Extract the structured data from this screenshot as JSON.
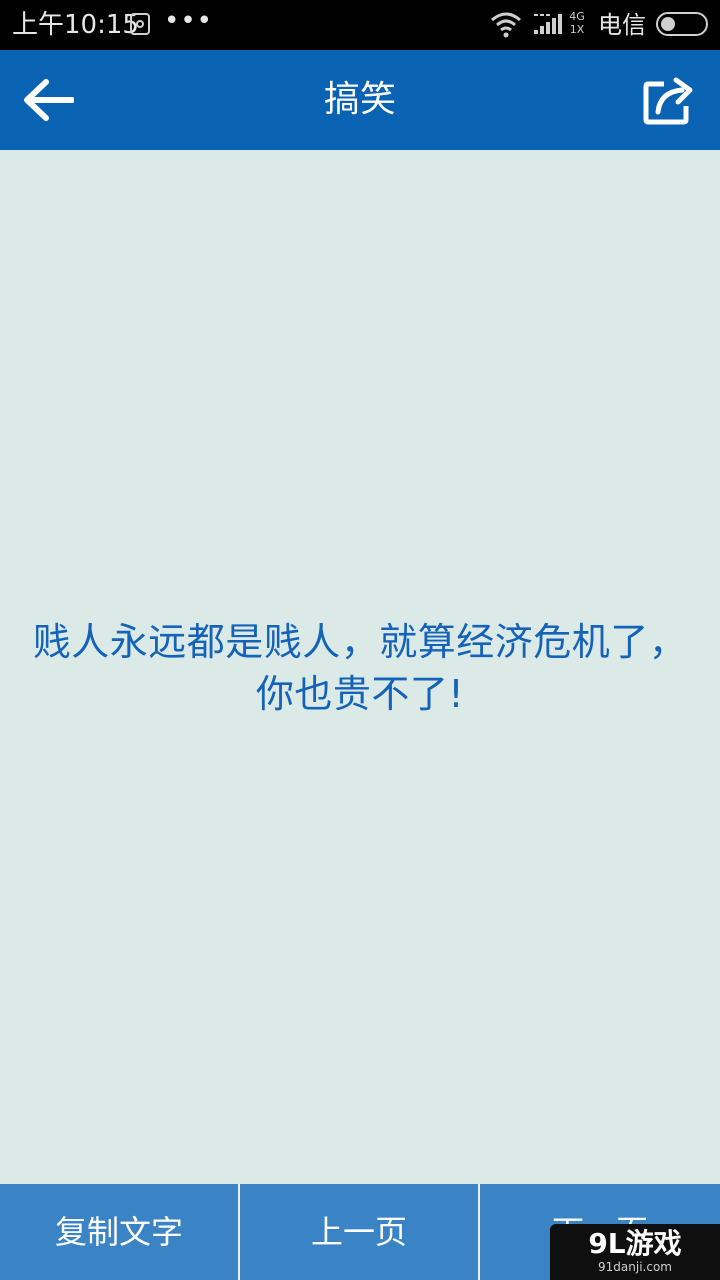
{
  "status_bar": {
    "time": "上午10:15",
    "more": "•••",
    "network_top": "4G",
    "network_bottom": "1X",
    "carrier": "电信",
    "icons": [
      "app-notification-icon",
      "wifi-icon",
      "signal-icon",
      "battery-icon"
    ]
  },
  "header": {
    "title": "搞笑",
    "back_icon": "arrow-left-icon",
    "share_icon": "share-icon",
    "color": "#0962b2"
  },
  "content": {
    "text": "贱人永远都是贱人，就算经济危机了，你也贵不了!",
    "text_color": "#1463b8",
    "background": "#dceae7"
  },
  "bottom_bar": {
    "copy_label": "复制文字",
    "prev_label": "上一页",
    "next_label": "下一页",
    "color": "#3a84c6"
  },
  "watermark": {
    "brand": "9L游戏",
    "site": "91danji.com"
  }
}
